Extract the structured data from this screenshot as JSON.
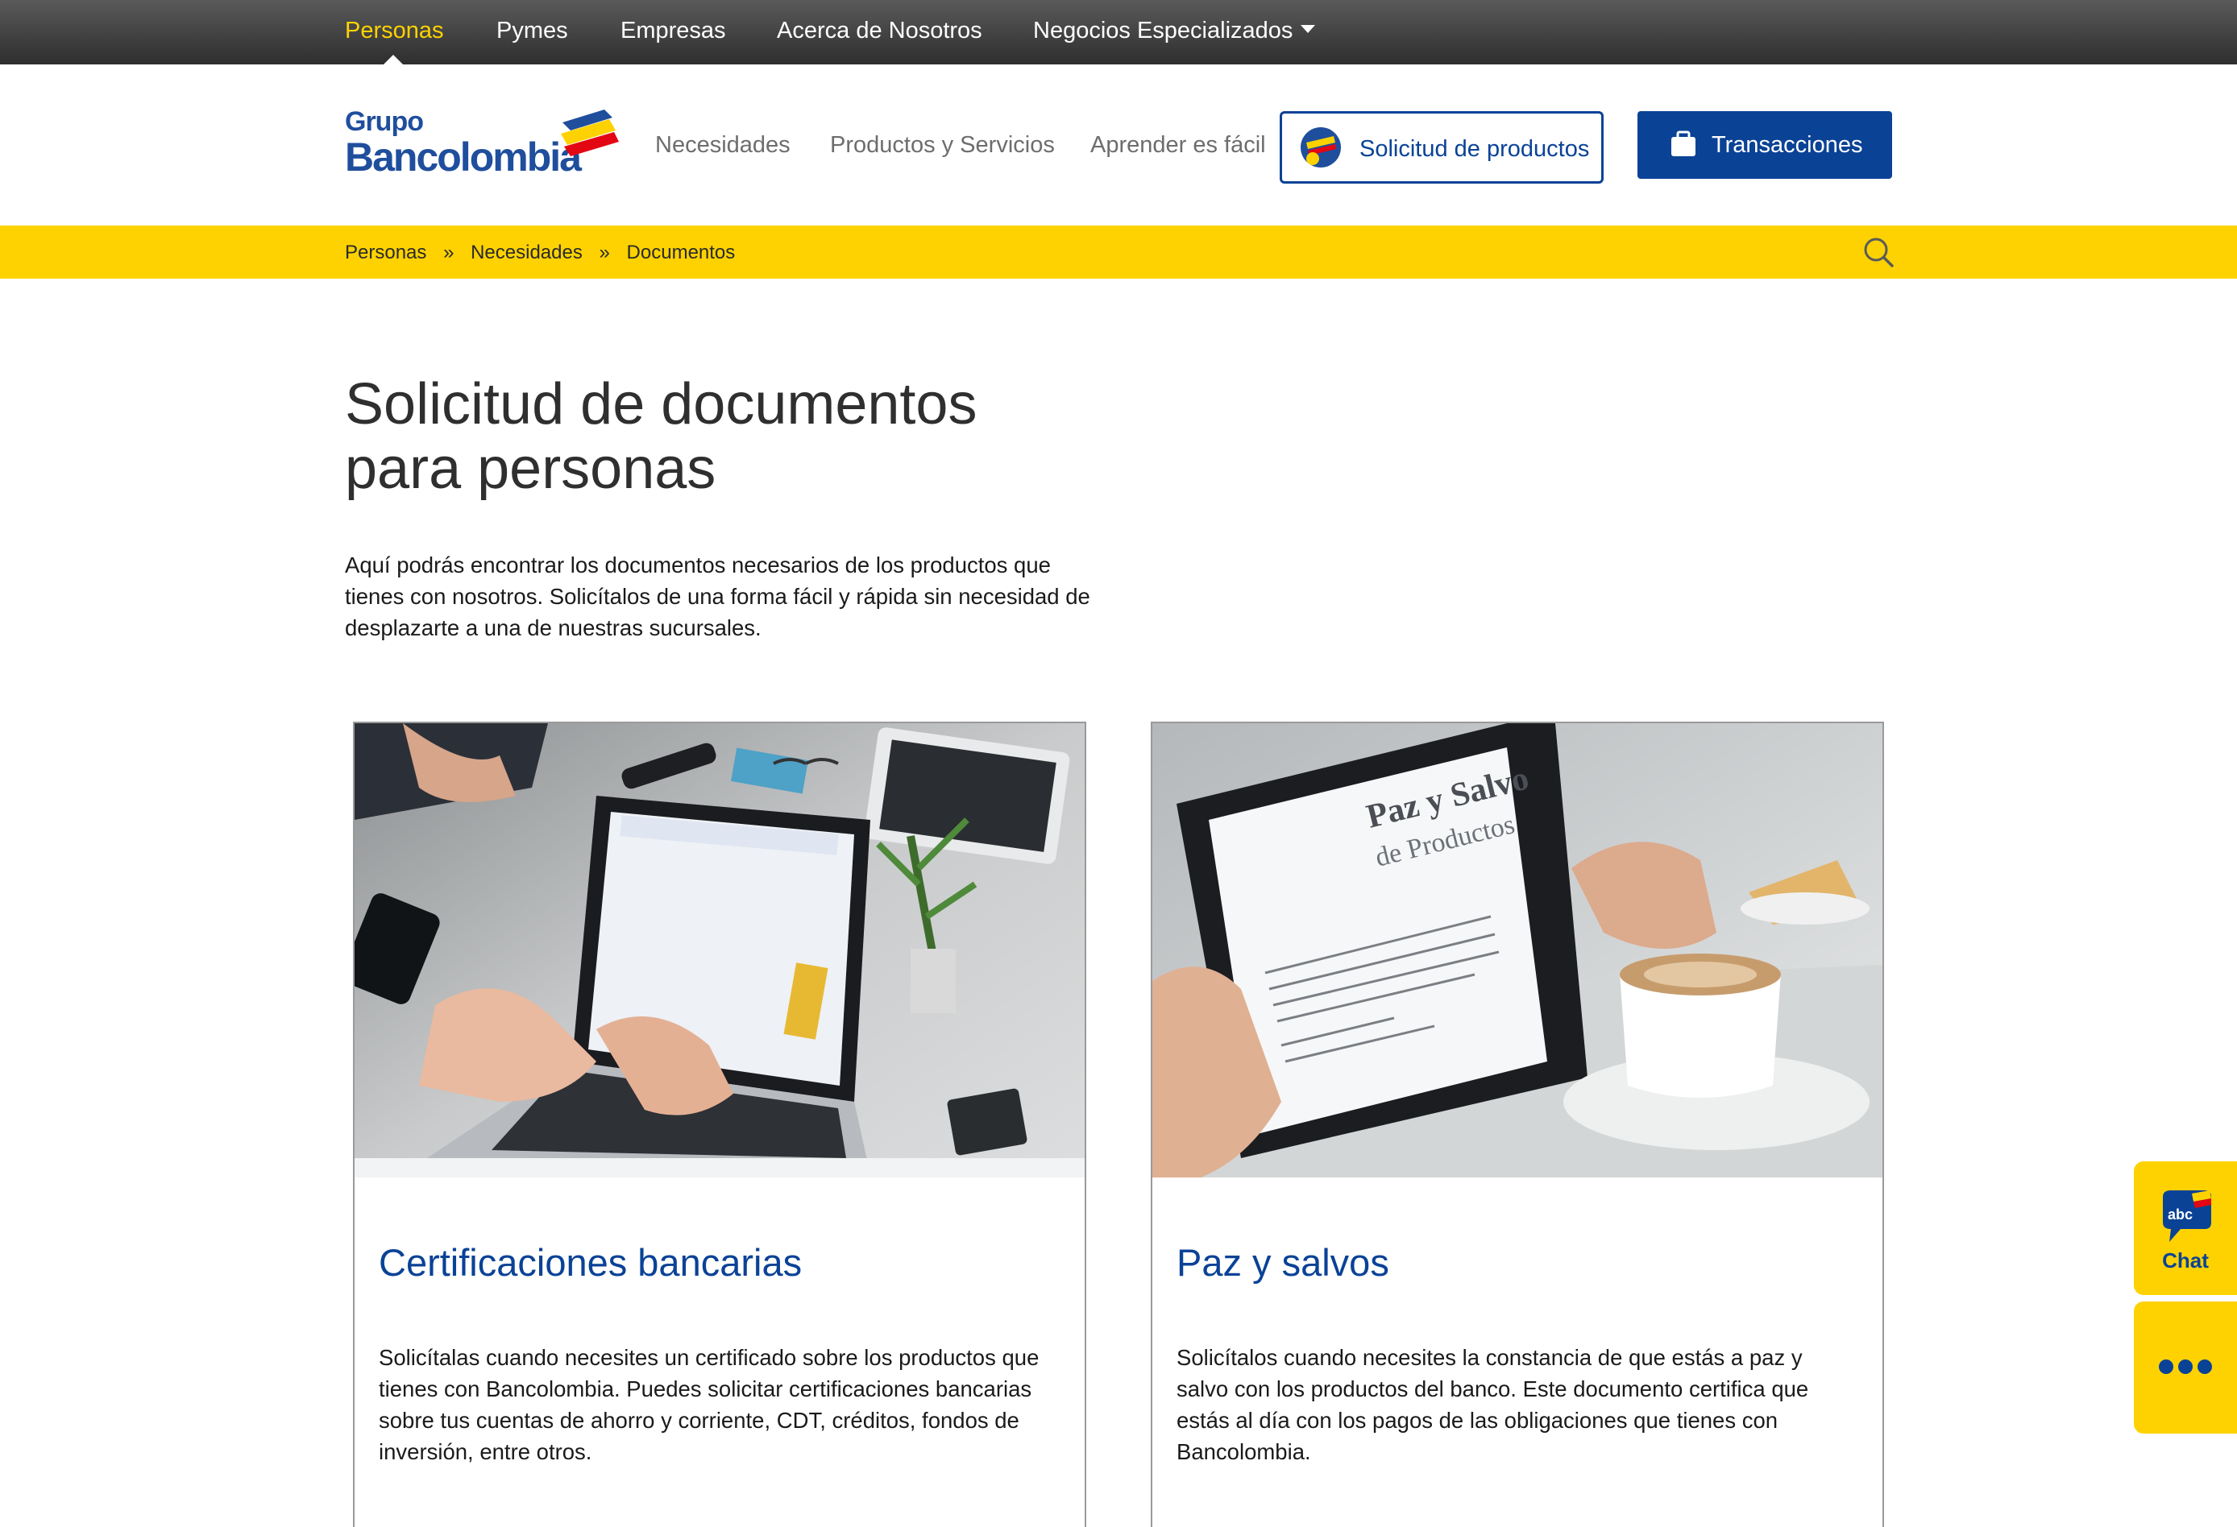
{
  "topnav": {
    "items": [
      "Personas",
      "Pymes",
      "Empresas",
      "Acerca de Nosotros",
      "Negocios Especializados"
    ],
    "active": "Personas"
  },
  "header": {
    "logo_line1": "Grupo",
    "logo_line2": "Bancolombia",
    "nav": [
      "Necesidades",
      "Productos y Servicios",
      "Aprender es fácil"
    ],
    "solicitud_label": "Solicitud de productos",
    "transacciones_label": "Transacciones"
  },
  "breadcrumb": {
    "items": [
      "Personas",
      "Necesidades",
      "Documentos"
    ],
    "separator": "»"
  },
  "main": {
    "title_line1": "Solicitud de documentos",
    "title_line2": "para personas",
    "intro": "Aquí podrás encontrar los documentos necesarios de los productos que tienes con nosotros. Solicítalos de una forma fácil y rápida sin necesidad de desplazarte a una de nuestras sucursales."
  },
  "cards": [
    {
      "title": "Certificaciones bancarias",
      "text": "Solicítalas cuando necesites un certificado sobre los productos que tienes con Bancolombia. Puedes solicitar certificaciones bancarias sobre tus cuentas de ahorro y corriente, CDT, créditos, fondos de inversión, entre otros."
    },
    {
      "title": "Paz y salvos",
      "text": "Solicítalos cuando necesites la constancia de que estás a paz y salvo con los productos del banco. Este documento certifica que estás al día con los pagos de las obligaciones que tienes con Bancolombia.",
      "image_text_line1": "Paz y Salvo",
      "image_text_line2": "de Productos"
    }
  ],
  "floating": {
    "chat_badge": "abc",
    "chat_label": "Chat"
  },
  "colors": {
    "brand_blue": "#0a4296",
    "brand_yellow": "#fdd200",
    "topbar": "#3a3a3a"
  },
  "icons": [
    "caret-down-icon",
    "bancolombia-logo",
    "solicitud-icon",
    "briefcase-icon",
    "search-icon",
    "chat-bubble-icon",
    "more-dots-icon"
  ]
}
